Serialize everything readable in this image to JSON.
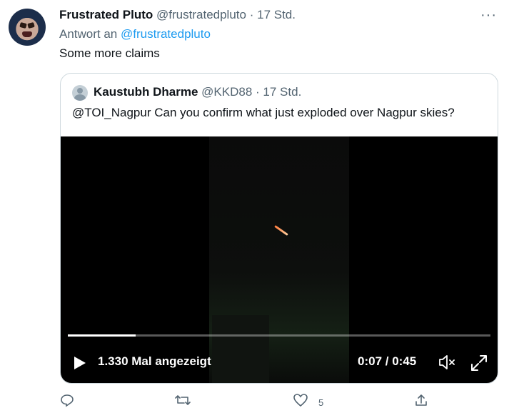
{
  "tweet": {
    "author_name": "Frustrated Pluto",
    "author_handle": "@frustratedpluto",
    "separator": "·",
    "time": "17 Std.",
    "reply_prefix": "Antwort an",
    "reply_to": "@frustratedpluto",
    "text": "Some more claims",
    "more_label": "···"
  },
  "quote": {
    "author_name": "Kaustubh Dharme",
    "author_handle": "@KKD88",
    "separator": "·",
    "time": "17 Std.",
    "text": "@TOI_Nagpur Can you confirm what just exploded over Nagpur skies?"
  },
  "video": {
    "views": "1.330 Mal angezeigt",
    "duration": "0:07 / 0:45",
    "progress": 0.16
  },
  "actions": {
    "like_count": "5"
  },
  "colors": {
    "link": "#1d9bf0",
    "secondary_text": "#536471",
    "border": "#cfd9de"
  }
}
